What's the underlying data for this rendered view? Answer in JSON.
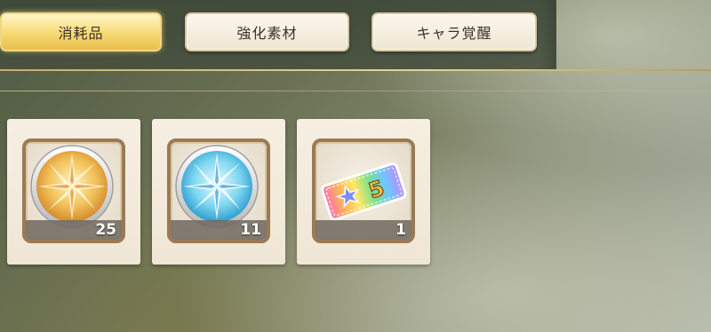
{
  "tabs": [
    {
      "label": "消耗品",
      "active": true
    },
    {
      "label": "強化素材",
      "active": false
    },
    {
      "label": "キャラ覚醒",
      "active": false
    }
  ],
  "items": [
    {
      "icon": "gold-crystal-medal-icon",
      "count": "25"
    },
    {
      "icon": "blue-crystal-medal-icon",
      "count": "11"
    },
    {
      "icon": "rainbow-star5-ticket-icon",
      "count": "1"
    }
  ],
  "colors": {
    "tab_active": "#f6d975",
    "tab_inactive": "#f5efe0",
    "card_bg": "#f3ecdf",
    "frame_border": "#9a7a55",
    "accent_line": "#d8bd7c"
  }
}
